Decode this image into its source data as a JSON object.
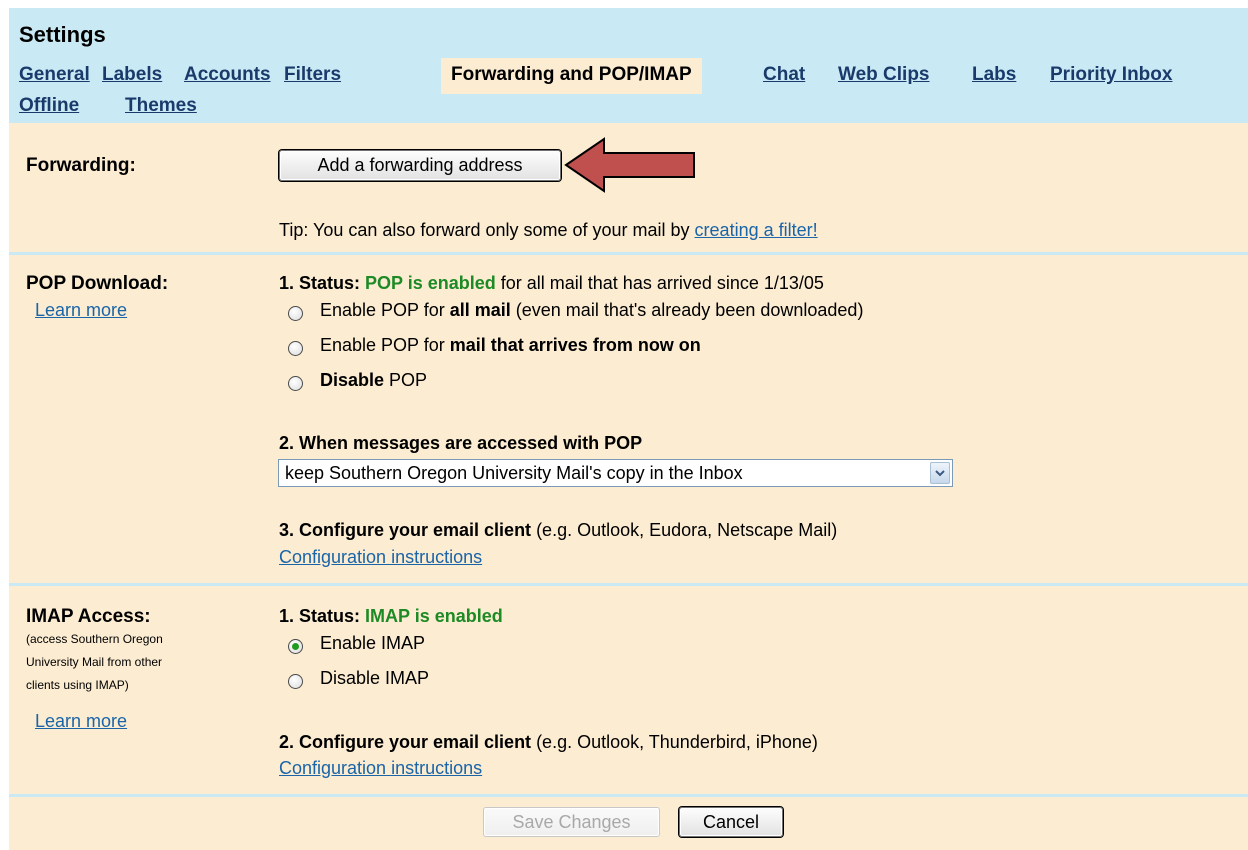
{
  "header": {
    "title": "Settings",
    "tabs": [
      "General",
      "Labels",
      "Accounts",
      "Filters",
      "Forwarding and POP/IMAP",
      "Chat",
      "Web Clips",
      "Labs",
      "Priority Inbox",
      "Offline",
      "Themes"
    ],
    "active_tab": "Forwarding and POP/IMAP"
  },
  "forwarding": {
    "label": "Forwarding:",
    "add_button": "Add a forwarding address",
    "tip_prefix": "Tip: You can also forward only some of your mail by ",
    "tip_link": "creating a filter!"
  },
  "pop": {
    "label": "POP Download:",
    "learn_more": "Learn more",
    "status_prefix": "1. Status: ",
    "status_value": "POP is enabled",
    "status_suffix": " for all mail that has arrived since 1/13/05",
    "opt1_a": "Enable POP for ",
    "opt1_b": "all mail",
    "opt1_c": " (even mail that's already been downloaded)",
    "opt2_a": "Enable POP for ",
    "opt2_b": "mail that arrives from now on",
    "opt3_a": "Disable",
    "opt3_b": " POP",
    "step2": "2. When messages are accessed with POP",
    "select_value": "keep Southern Oregon University Mail's copy in the Inbox",
    "step3_a": "3. Configure your email client",
    "step3_b": " (e.g. Outlook, Eudora, Netscape Mail)",
    "config_link": "Configuration instructions"
  },
  "imap": {
    "label": "IMAP Access:",
    "desc1": "(access Southern Oregon",
    "desc2": "University Mail from other",
    "desc3": "clients using IMAP)",
    "learn_more": "Learn more",
    "status_prefix": "1. Status: ",
    "status_value": "IMAP is enabled",
    "opt_enable": "Enable IMAP",
    "opt_disable": "Disable IMAP",
    "selected": "Enable IMAP",
    "step2_a": "2. Configure your email client",
    "step2_b": " (e.g. Outlook, Thunderbird, iPhone)",
    "config_link": "Configuration instructions"
  },
  "footer": {
    "save": "Save Changes",
    "cancel": "Cancel"
  },
  "colors": {
    "header_bg": "#c9eaf4",
    "body_bg": "#fbecd2",
    "status_green": "#1d8a25",
    "link": "#1a64a8",
    "annotation_arrow": "#c0504d"
  }
}
